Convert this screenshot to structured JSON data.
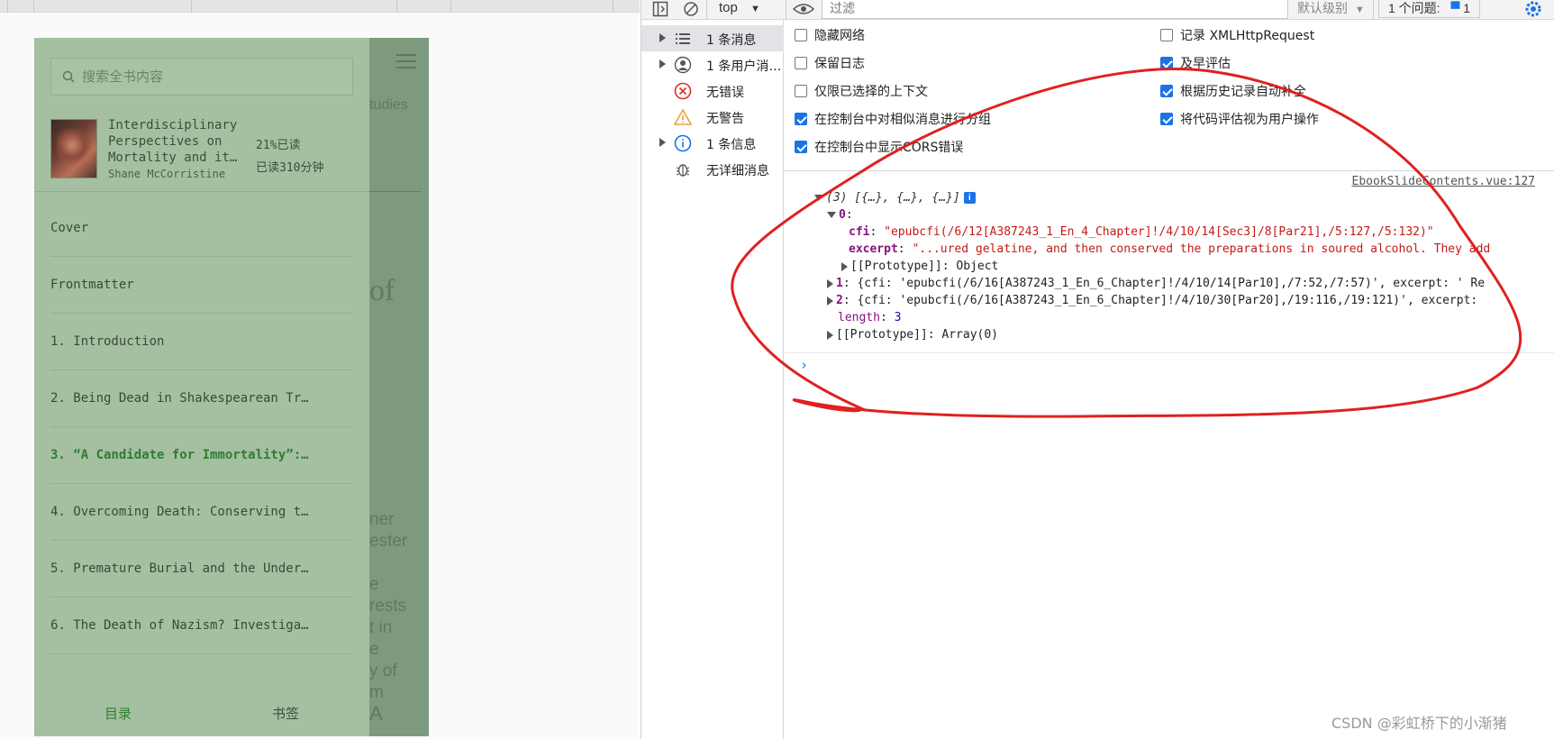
{
  "reader": {
    "search_placeholder": "搜索全书内容",
    "book": {
      "title": "Interdisciplinary\nPerspectives on\nMortality and it…",
      "author": "Shane McCorristine",
      "progress": "21%已读",
      "time_read": "已读310分钟"
    },
    "toc": [
      "Cover",
      "Frontmatter",
      "1. Introduction",
      "2. Being Dead in Shakespearean Tr…",
      "3. “A Candidate for Immortality”:…",
      "4. Overcoming Death: Conserving t…",
      "5. Premature Burial and the Under…",
      "6. The Death of Nazism? Investiga…"
    ],
    "active_toc_index": 4,
    "tabs": {
      "toc": "目录",
      "bookmarks": "书签"
    },
    "background": {
      "studies": "tudies",
      "of": "of",
      "lines": [
        "ner",
        "ester",
        "",
        "e",
        "rests",
        "t in",
        "e",
        "y of",
        "m"
      ],
      "big_a": "A"
    }
  },
  "devtools": {
    "toolbar": {
      "context": "top",
      "filter_placeholder": "过滤",
      "level": "默认级别",
      "issues": "1 个问题:",
      "issues_count": "1"
    },
    "sidebar": [
      {
        "label": "1 条消息",
        "icon": "list-icon",
        "expandable": true,
        "selected": true
      },
      {
        "label": "1 条用户消…",
        "icon": "user-icon",
        "expandable": true,
        "selected": false
      },
      {
        "label": "无错误",
        "icon": "error-icon",
        "expandable": false,
        "selected": false
      },
      {
        "label": "无警告",
        "icon": "warning-icon",
        "expandable": false,
        "selected": false
      },
      {
        "label": "1 条信息",
        "icon": "info-icon",
        "expandable": true,
        "selected": false
      },
      {
        "label": "无详细消息",
        "icon": "bug-icon",
        "expandable": false,
        "selected": false
      }
    ],
    "settings_left": [
      {
        "label": "隐藏网络",
        "checked": false
      },
      {
        "label": "保留日志",
        "checked": false
      },
      {
        "label": "仅限已选择的上下文",
        "checked": false
      },
      {
        "label": "在控制台中对相似消息进行分组",
        "checked": true
      },
      {
        "label": "在控制台中显示CORS错误",
        "checked": true
      }
    ],
    "settings_right": [
      {
        "label": "记录 XMLHttpRequest",
        "checked": false
      },
      {
        "label": "及早评估",
        "checked": true
      },
      {
        "label": "根据历史记录自动补全",
        "checked": true
      },
      {
        "label": "将代码评估视为用户操作",
        "checked": true
      }
    ],
    "console": {
      "source": "EbookSlideContents.vue:127",
      "summary": "(3) [{…}, {…}, {…}]",
      "item0_key": "0",
      "cfi_key": "cfi",
      "cfi0": "\"epubcfi(/6/12[A387243_1_En_4_Chapter]!/4/10/14[Sec3]/8[Par21],/5:127,/5:132)\"",
      "excerpt_key": "excerpt",
      "excerpt0": "\"...ured gelatine, and then conserved the preparations in soured alcohol. They add",
      "proto_obj": "[[Prototype]]: Object",
      "item1_key": "1",
      "item1": "{cfi: 'epubcfi(/6/16[A387243_1_En_6_Chapter]!/4/10/14[Par10],/7:52,/7:57)', excerpt: ' Re",
      "item2_key": "2",
      "item2": "{cfi: 'epubcfi(/6/16[A387243_1_En_6_Chapter]!/4/10/30[Par20],/19:116,/19:121)', excerpt: ",
      "length_key": "length",
      "length_val": "3",
      "proto_arr": "[[Prototype]]: Array(0)",
      "prompt": "›"
    }
  },
  "watermark": "CSDN @彩虹桥下的小渐猪",
  "colors": {
    "accent_green": "#2f7d32",
    "devtools_blue": "#1a73e8",
    "annotation_red": "#e02020"
  }
}
